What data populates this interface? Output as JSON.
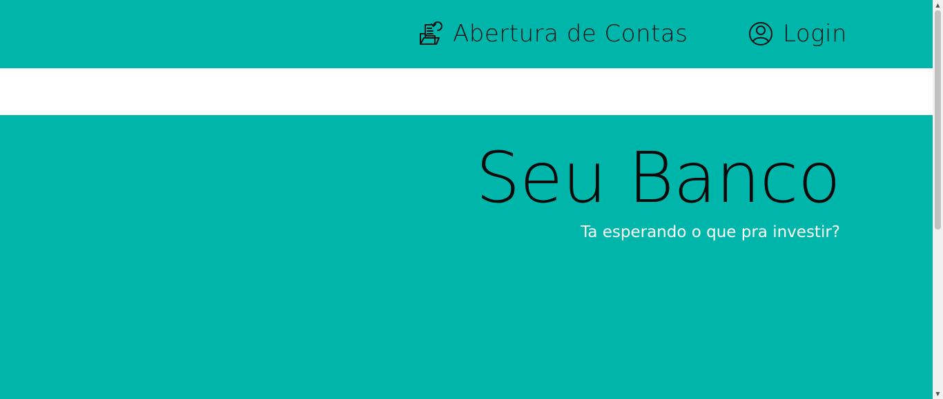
{
  "nav": {
    "open_account": {
      "label": "Abertura de Contas",
      "icon": "folder-upload-icon"
    },
    "login": {
      "label": "Login",
      "icon": "user-circle-icon"
    }
  },
  "hero": {
    "title": "Seu Banco",
    "subtitle": "Ta esperando o que pra investir?"
  },
  "colors": {
    "brand": "#00b5aa",
    "text_dark": "#0a0a0a",
    "text_light": "#ffffff"
  },
  "scrollbar": {
    "up_arrow_icon": "scroll-up-icon",
    "down_arrow_icon": "scroll-down-icon"
  }
}
